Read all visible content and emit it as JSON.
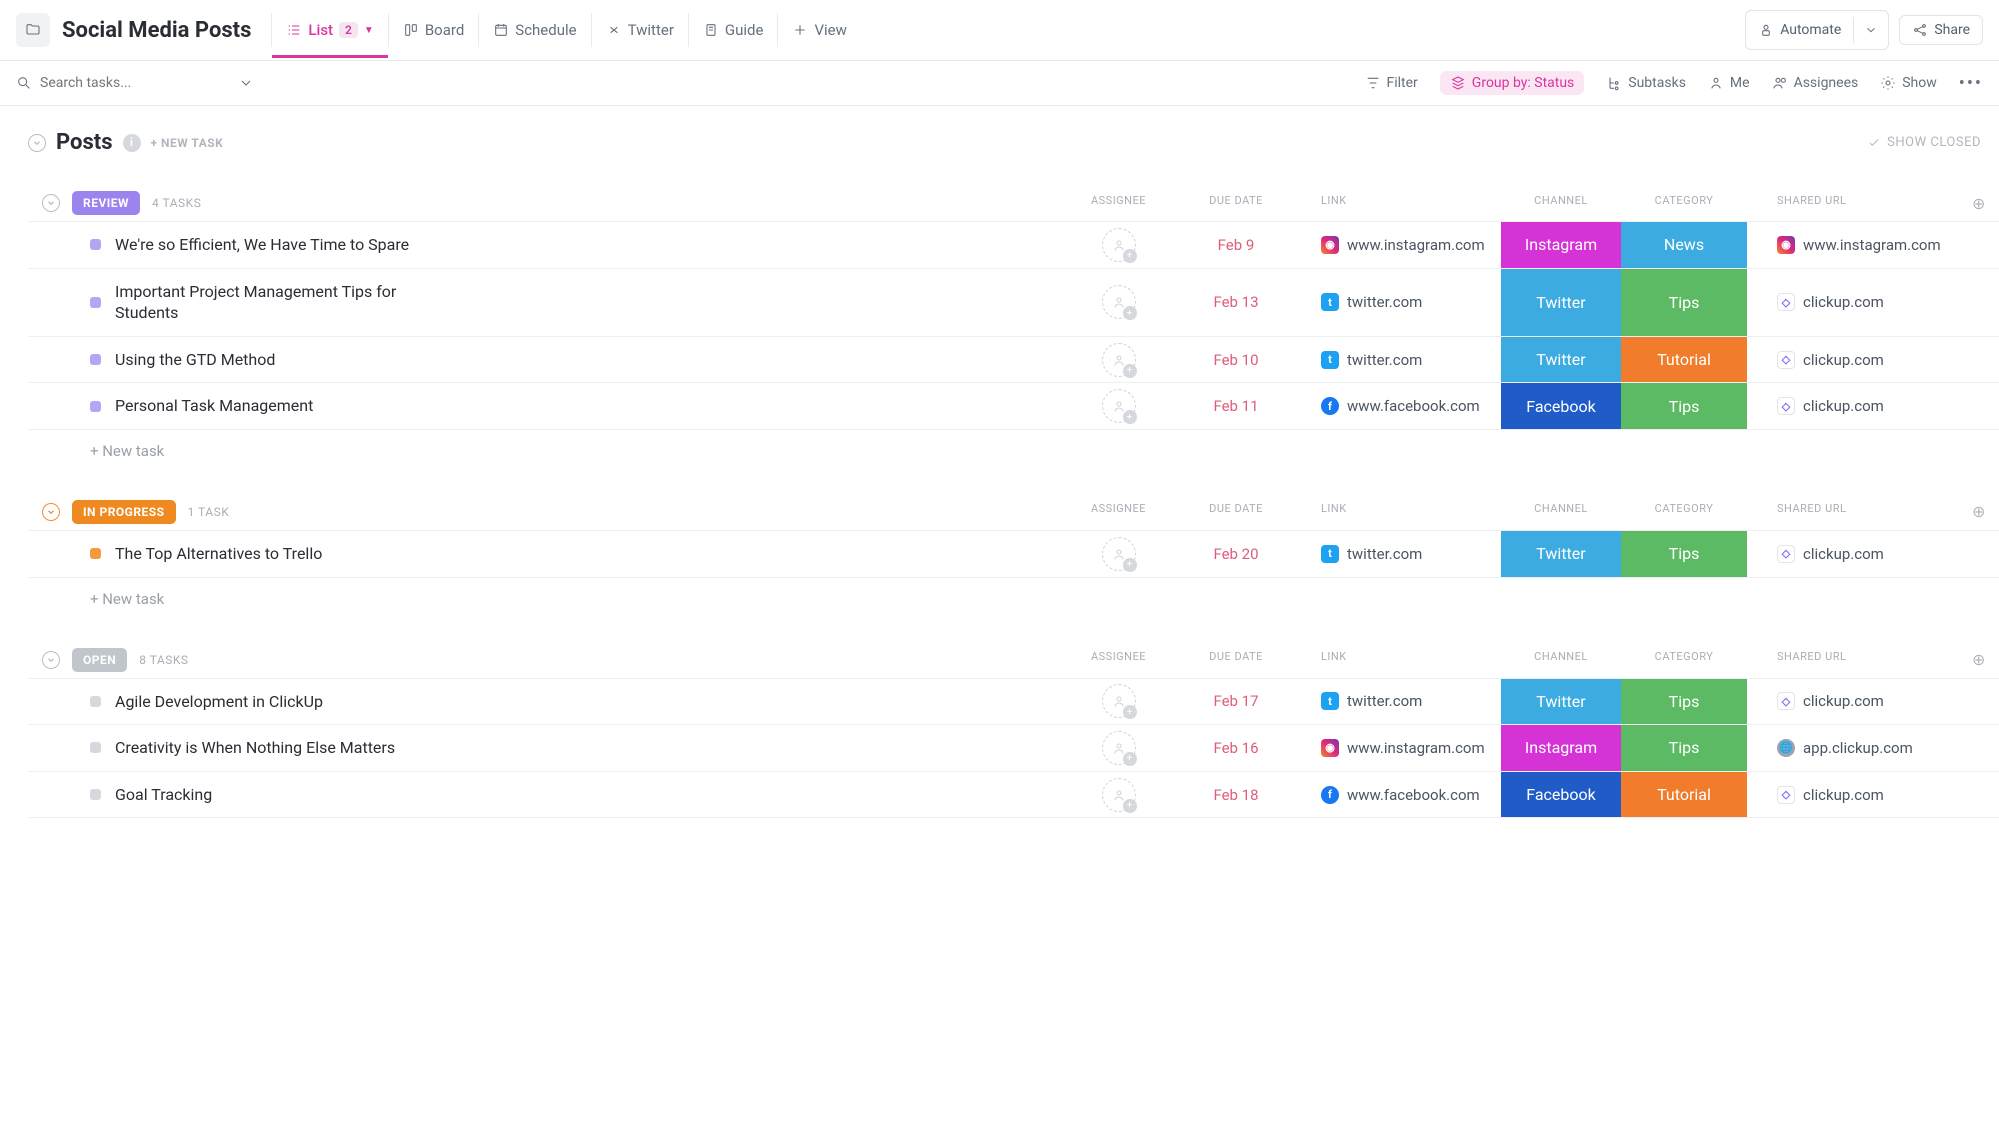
{
  "page_title": "Social Media Posts",
  "tabs": [
    {
      "label": "List",
      "badge": "2",
      "active": true
    },
    {
      "label": "Board"
    },
    {
      "label": "Schedule"
    },
    {
      "label": "Twitter"
    },
    {
      "label": "Guide"
    },
    {
      "label": "View"
    }
  ],
  "header_buttons": {
    "automate": "Automate",
    "share": "Share"
  },
  "search_placeholder": "Search tasks...",
  "toolbar": {
    "filter": "Filter",
    "groupby": "Group by: Status",
    "subtasks": "Subtasks",
    "me": "Me",
    "assignees": "Assignees",
    "show": "Show"
  },
  "posts_title": "Posts",
  "new_task_top": "+ NEW TASK",
  "show_closed": "SHOW CLOSED",
  "columns": {
    "assignee": "ASSIGNEE",
    "due_date": "DUE DATE",
    "link": "LINK",
    "channel": "CHANNEL",
    "category": "CATEGORY",
    "shared_url": "SHARED URL"
  },
  "new_task_row": "+ New task",
  "groups": [
    {
      "status": "REVIEW",
      "status_class": "status-review",
      "sq": "sq-review",
      "count": "4 TASKS",
      "collapse": "",
      "rows": [
        {
          "title": "We're so Efficient, We Have Time to Spare",
          "date": "Feb 9",
          "link": "www.instagram.com",
          "link_ic": "ic-ig",
          "channel": "Instagram",
          "chan_class": "chan-instagram",
          "category": "News",
          "cat_class": "cat-news",
          "url": "www.instagram.com",
          "url_ic": "ic-ig"
        },
        {
          "title": "Important Project Management Tips for Students",
          "date": "Feb 13",
          "link": "twitter.com",
          "link_ic": "ic-tw",
          "channel": "Twitter",
          "chan_class": "chan-twitter",
          "category": "Tips",
          "cat_class": "cat-tips",
          "url": "clickup.com",
          "url_ic": "ic-cu"
        },
        {
          "title": "Using the GTD Method",
          "date": "Feb 10",
          "link": "twitter.com",
          "link_ic": "ic-tw",
          "channel": "Twitter",
          "chan_class": "chan-twitter",
          "category": "Tutorial",
          "cat_class": "cat-tutorial",
          "url": "clickup.com",
          "url_ic": "ic-cu"
        },
        {
          "title": "Personal Task Management",
          "date": "Feb 11",
          "link": "www.facebook.com",
          "link_ic": "ic-fb",
          "channel": "Facebook",
          "chan_class": "chan-facebook",
          "category": "Tips",
          "cat_class": "cat-tips",
          "url": "clickup.com",
          "url_ic": "ic-cu"
        }
      ]
    },
    {
      "status": "IN PROGRESS",
      "status_class": "status-inprogress",
      "sq": "sq-ip",
      "count": "1 TASK",
      "collapse": "orange",
      "rows": [
        {
          "title": "The Top Alternatives to Trello",
          "date": "Feb 20",
          "link": "twitter.com",
          "link_ic": "ic-tw",
          "channel": "Twitter",
          "chan_class": "chan-twitter",
          "category": "Tips",
          "cat_class": "cat-tips",
          "url": "clickup.com",
          "url_ic": "ic-cu"
        }
      ]
    },
    {
      "status": "OPEN",
      "status_class": "status-open",
      "sq": "sq-open",
      "count": "8 TASKS",
      "collapse": "",
      "rows": [
        {
          "title": "Agile Development in ClickUp",
          "date": "Feb 17",
          "link": "twitter.com",
          "link_ic": "ic-tw",
          "channel": "Twitter",
          "chan_class": "chan-twitter",
          "category": "Tips",
          "cat_class": "cat-tips",
          "url": "clickup.com",
          "url_ic": "ic-cu"
        },
        {
          "title": "Creativity is When Nothing Else Matters",
          "date": "Feb 16",
          "link": "www.instagram.com",
          "link_ic": "ic-ig",
          "channel": "Instagram",
          "chan_class": "chan-instagram",
          "category": "Tips",
          "cat_class": "cat-tips",
          "url": "app.clickup.com",
          "url_ic": "ic-globe"
        },
        {
          "title": "Goal Tracking",
          "date": "Feb 18",
          "link": "www.facebook.com",
          "link_ic": "ic-fb",
          "channel": "Facebook",
          "chan_class": "chan-facebook",
          "category": "Tutorial",
          "cat_class": "cat-tutorial",
          "url": "clickup.com",
          "url_ic": "ic-cu"
        }
      ],
      "no_new_task": true
    }
  ]
}
